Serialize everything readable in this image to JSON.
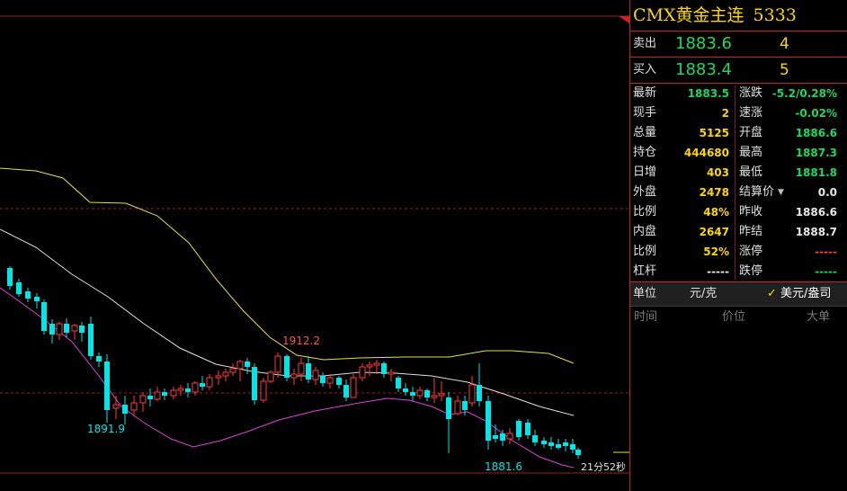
{
  "chart": {
    "annotations": {
      "high": "1912.2",
      "low_left": "1891.9",
      "low_right": "1881.6"
    },
    "timer": "21分52秒"
  },
  "colors": {
    "up": "#ff3b3b",
    "down": "#00e5e5",
    "upper_band": "#e8e23c",
    "mid_band": "#e0e0e0",
    "lower_band": "#e040e0",
    "grid": "#a01e1e"
  },
  "panel": {
    "title_name": "CMX黄金主连",
    "title_code": "5333",
    "sell": {
      "label": "卖出",
      "price": "1883.6",
      "volume": "4"
    },
    "buy": {
      "label": "买入",
      "price": "1883.4",
      "volume": "5"
    },
    "stats_left": [
      {
        "label": "最新",
        "value": "1883.5",
        "color": "green"
      },
      {
        "label": "现手",
        "value": "2",
        "color": "yellow"
      },
      {
        "label": "总量",
        "value": "5125",
        "color": "yellow"
      },
      {
        "label": "持仓",
        "value": "444680",
        "color": "yellow"
      },
      {
        "label": "日增",
        "value": "403",
        "color": "yellow"
      },
      {
        "label": "外盘",
        "value": "2478",
        "color": "yellow"
      },
      {
        "label": "比例",
        "value": "48%",
        "color": "yellow"
      },
      {
        "label": "内盘",
        "value": "2647",
        "color": "yellow"
      },
      {
        "label": "比例",
        "value": "52%",
        "color": "yellow"
      },
      {
        "label": "杠杆",
        "value": "-----",
        "color": "white"
      }
    ],
    "stats_right": [
      {
        "label": "涨跌",
        "value": "-5.2/0.28%",
        "color": "green"
      },
      {
        "label": "速涨",
        "value": "-0.02%",
        "color": "green"
      },
      {
        "label": "开盘",
        "value": "1886.6",
        "color": "green"
      },
      {
        "label": "最高",
        "value": "1887.3",
        "color": "green"
      },
      {
        "label": "最低",
        "value": "1881.8",
        "color": "green"
      },
      {
        "label": "结算价",
        "value": "0.0",
        "color": "white"
      },
      {
        "label": "昨收",
        "value": "1886.6",
        "color": "white"
      },
      {
        "label": "昨结",
        "value": "1888.7",
        "color": "white"
      },
      {
        "label": "涨停",
        "value": "-----",
        "color": "red"
      },
      {
        "label": "跌停",
        "value": "-----",
        "color": "green"
      }
    ],
    "unit_label": "单位",
    "unit_cny": "元/克",
    "unit_check": "✓",
    "unit_usd": "美元/盎司",
    "header": {
      "time": "时间",
      "price": "价位",
      "big": "大单"
    }
  }
}
